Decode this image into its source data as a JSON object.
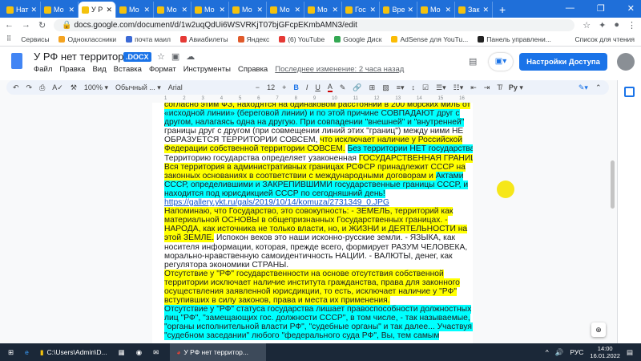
{
  "browser": {
    "tabs": [
      "Нат",
      "Мо",
      "У Р",
      "Мо",
      "Мо",
      "Мо",
      "Мо",
      "Мо",
      "Мо",
      "Гос",
      "Вре",
      "Мо",
      "Зак"
    ],
    "active_tab": 2,
    "url": "docs.google.com/document/d/1w2uqQdUi6WSVRKjT07bjGFcpEKmbAMN3/edit",
    "bookmarks": [
      "Сервисы",
      "Одноклассники",
      "почта маил",
      "Авиабилеты",
      "Яндекс",
      "(6) YouTube",
      "Google Диск",
      "AdSense для YouTu...",
      "Панель управлени..."
    ],
    "reading_list": "Список для чтения"
  },
  "doc": {
    "title": "У РФ нет территории",
    "badge": ".DOCX",
    "menu": [
      "Файл",
      "Правка",
      "Вид",
      "Вставка",
      "Формат",
      "Инструменты",
      "Справка"
    ],
    "last_edit": "Последнее изменение: 2 часа назад",
    "share": "Настройки Доступа"
  },
  "toolbar": {
    "zoom": "100%",
    "style": "Обычный ...",
    "font": "Arial",
    "size": "12",
    "bold": "B",
    "italic": "I",
    "underline": "U",
    "color": "A",
    "input": "Ру"
  },
  "ruler": [
    "1",
    "2",
    "3",
    "4",
    "5",
    "6",
    "7",
    "8",
    "9",
    "10",
    "11",
    "12",
    "13",
    "14",
    "15",
    "16"
  ],
  "lines": [
    [
      [
        "y",
        "согласно этим ФЗ, находятся на одинаковом расстоянии в 200 морских миль от"
      ]
    ],
    [
      [
        "c",
        "«исходной линии» (береговой линии) и по этой причине СОВПАДАЮТ друг с"
      ]
    ],
    [
      [
        "c",
        "другом, налагаясь одна на другую. При совпадении \"внешней\" и \"внутренней\""
      ]
    ],
    [
      [
        "n",
        "границы друг с другом (при совмещении линий этих \"границ\") между ними НЕ"
      ]
    ],
    [
      [
        "n",
        "ОБРАЗУЕТСЯ ТЕРРИТОРИИ СОВСЕМ, "
      ],
      [
        "y",
        "что исключает наличие у Российской"
      ]
    ],
    [
      [
        "y",
        "Федерации собственной территории СОВСЕМ."
      ],
      [
        "n",
        " "
      ],
      [
        "c",
        "Без территории НЕТ государства. -"
      ]
    ],
    [
      [
        "n",
        "Территорию государства определяет узаконенная "
      ],
      [
        "y",
        "ГОСУДАРСТВЕННАЯ ГРАНИЦА."
      ]
    ],
    [
      [
        "y",
        "Вся территория в административных границах РСФСР принадлежит СССР на"
      ]
    ],
    [
      [
        "y",
        "законных основаниях в соответствии с международными договорам и "
      ],
      [
        "c",
        "Актами"
      ]
    ],
    [
      [
        "c",
        "СССР, определившими и ЗАКРЕПИВШИМИ государственные границы СССР, и"
      ]
    ],
    [
      [
        "c",
        "находится под юрисдикцией СССР по сегодняшний день!"
      ]
    ],
    [
      [
        "l",
        "https://gallery.ykt.ru/gals/2019/10/14/komuza/2731349_0.JPG"
      ]
    ],
    [
      [
        "y",
        " Напоминаю, что Государство, это совокупность: - ЗЕМЕЛЬ, территорий как"
      ]
    ],
    [
      [
        "y",
        "материальной ОСНОВЫ в общепризнанных Государственных границах. -"
      ]
    ],
    [
      [
        "y",
        "НАРОДА, как источника не только власти, но, и ЖИЗНИ и ДЕЯТЕЛЬНОСТИ на"
      ]
    ],
    [
      [
        "y",
        "этой ЗЕМЛЕ."
      ],
      [
        "n",
        " Испокон веков это наши исконно-русские земли. - ЯЗЫКА, как"
      ]
    ],
    [
      [
        "n",
        "носителя информации, которая, прежде всего, формирует РАЗУМ ЧЕЛОВЕКА,"
      ]
    ],
    [
      [
        "n",
        "морально-нравственную самоидентичность НАЦИИ. - ВАЛЮТЫ, денег, как"
      ]
    ],
    [
      [
        "n",
        "регулятора экономики СТРАНЫ."
      ]
    ],
    [
      [
        "y",
        " Отсутствие у \"РФ\" государственности на основе отсутствия собственной"
      ]
    ],
    [
      [
        "y",
        "территории исключает наличие института гражданства, права для законного"
      ]
    ],
    [
      [
        "y",
        "осуществления заявленной юрисдикции, то есть, исключает наличие у \"РФ\""
      ]
    ],
    [
      [
        "y",
        "вступивших в силу законов, права и места их применения."
      ]
    ],
    [
      [
        "c",
        " Отсутствие у \"РФ\" статуса государства лишает правоспособности должностных"
      ]
    ],
    [
      [
        "c",
        "лиц \"РФ\", \"замещающих гос. должности СССР\", в том числе, - так называемые,"
      ]
    ],
    [
      [
        "c",
        "\"органы исполнительной власти РФ\", \"судебные органы\" и так далее... Участвуя в"
      ]
    ],
    [
      [
        "c",
        "\"судебном заседании\" любого \"федерального суда РФ\", Вы, тем самым"
      ]
    ]
  ],
  "taskbar": {
    "explorer": "C:\\Users\\Admin\\D...",
    "chrome": "У РФ нет территор...",
    "lang": "РУС",
    "time": "14:00",
    "date": "16.01.2022"
  }
}
